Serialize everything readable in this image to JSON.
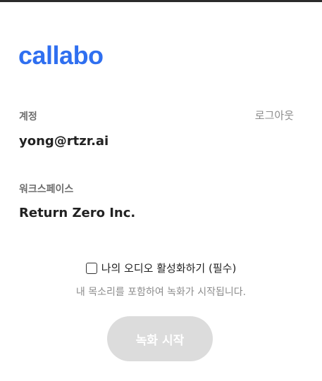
{
  "brand": {
    "logo_text": "callabo",
    "accent_color": "#2f6ff0"
  },
  "account": {
    "label": "계정",
    "value": "yong@rtzr.ai",
    "logout_label": "로그아웃"
  },
  "workspace": {
    "label": "워크스페이스",
    "value": "Return Zero Inc."
  },
  "audio_consent": {
    "checkbox_label": "나의 오디오 활성화하기 (필수)",
    "checked": false,
    "hint": "내 목소리를 포함하여 녹화가 시작됩니다."
  },
  "actions": {
    "start_recording_label": "녹화 시작",
    "start_recording_enabled": false
  }
}
